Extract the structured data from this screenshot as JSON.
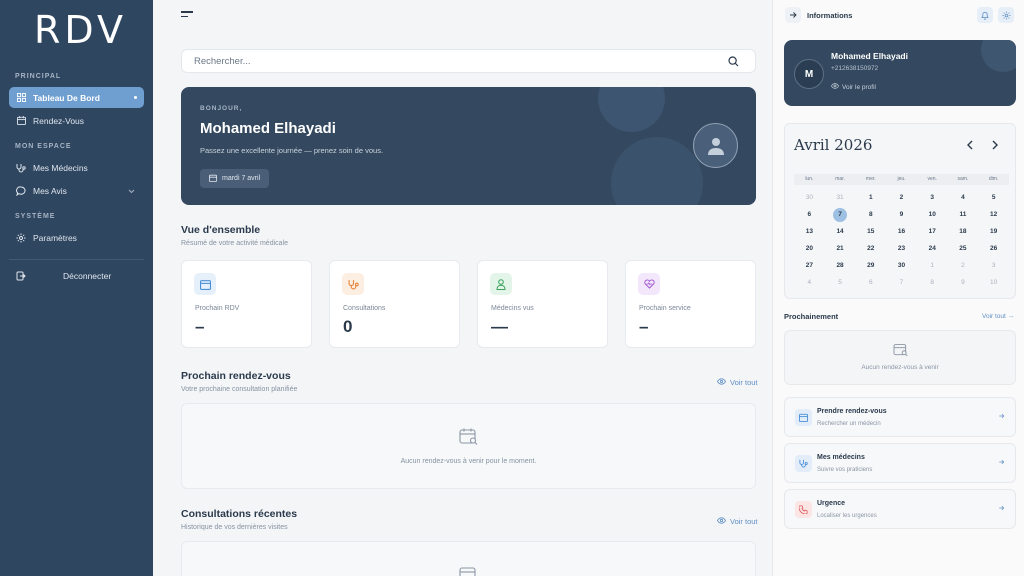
{
  "sidebar": {
    "logo": "RDV",
    "sections": [
      "PRINCIPAL",
      "MON ESPACE",
      "SYSTÈME"
    ],
    "items": [
      {
        "label": "Tableau De Bord",
        "icon": "grid-icon",
        "active": true
      },
      {
        "label": "Rendez-Vous",
        "icon": "calendar-icon"
      },
      {
        "label": "Mes Médecins",
        "icon": "stethoscope-icon"
      },
      {
        "label": "Mes Avis",
        "icon": "chat-bubble-icon"
      },
      {
        "label": "Paramètres",
        "icon": "gear-icon"
      }
    ],
    "logout": "Déconnecter"
  },
  "search": {
    "placeholder": "Rechercher..."
  },
  "hero": {
    "greeting": "BONJOUR,",
    "name": "Mohamed Elhayadi",
    "subtitle": "Passez une excellente journée — prenez soin de vous.",
    "date": "mardi 7 avril"
  },
  "overview": {
    "title": "Vue d'ensemble",
    "subtitle": "Résumé de votre activité médicale",
    "stats": [
      {
        "label": "Prochain RDV",
        "value": "–",
        "color": "#4a90d9",
        "bg": "#e6f0fb"
      },
      {
        "label": "Consultations",
        "value": "0",
        "color": "#e8843c",
        "bg": "#fdeee2"
      },
      {
        "label": "Médecins vus",
        "value": "—",
        "color": "#3aa15a",
        "bg": "#e2f5e8"
      },
      {
        "label": "Prochain service",
        "value": "–",
        "color": "#a05ad0",
        "bg": "#f3e8fb"
      }
    ]
  },
  "next_appointment": {
    "title": "Prochain rendez-vous",
    "subtitle": "Votre prochaine consultation planifiée",
    "link": "Voir tout",
    "empty": "Aucun rendez-vous à venir pour le moment."
  },
  "recent": {
    "title": "Consultations récentes",
    "subtitle": "Historique de vos dernières visites",
    "link": "Voir tout"
  },
  "right": {
    "title": "Informations",
    "profile": {
      "initial": "M",
      "name": "Mohamed Elhayadi",
      "phone": "+212638150972",
      "link": "Voir le profil"
    },
    "calendar": {
      "month": "Avril 2026",
      "weekdays": [
        "lun.",
        "mar.",
        "mer.",
        "jeu.",
        "ven.",
        "sam.",
        "dim."
      ],
      "days": [
        {
          "d": "30",
          "m": true
        },
        {
          "d": "31",
          "m": true
        },
        {
          "d": "1"
        },
        {
          "d": "2"
        },
        {
          "d": "3"
        },
        {
          "d": "4"
        },
        {
          "d": "5"
        },
        {
          "d": "6"
        },
        {
          "d": "7",
          "today": true
        },
        {
          "d": "8"
        },
        {
          "d": "9"
        },
        {
          "d": "10"
        },
        {
          "d": "11"
        },
        {
          "d": "12"
        },
        {
          "d": "13"
        },
        {
          "d": "14"
        },
        {
          "d": "15"
        },
        {
          "d": "16"
        },
        {
          "d": "17"
        },
        {
          "d": "18"
        },
        {
          "d": "19"
        },
        {
          "d": "20"
        },
        {
          "d": "21"
        },
        {
          "d": "22"
        },
        {
          "d": "23"
        },
        {
          "d": "24"
        },
        {
          "d": "25"
        },
        {
          "d": "26"
        },
        {
          "d": "27"
        },
        {
          "d": "28"
        },
        {
          "d": "29"
        },
        {
          "d": "30"
        },
        {
          "d": "1",
          "m": true
        },
        {
          "d": "2",
          "m": true
        },
        {
          "d": "3",
          "m": true
        },
        {
          "d": "4",
          "m": true
        },
        {
          "d": "5",
          "m": true
        },
        {
          "d": "6",
          "m": true
        },
        {
          "d": "7",
          "m": true
        },
        {
          "d": "8",
          "m": true
        },
        {
          "d": "9",
          "m": true
        },
        {
          "d": "10",
          "m": true
        }
      ]
    },
    "upcoming": {
      "title": "Prochainement",
      "link": "Voir tout →",
      "empty": "Aucun rendez-vous à venir"
    },
    "actions": [
      {
        "title": "Prendre rendez-vous",
        "sub": "Rechercher un médecin",
        "color": "#4a90d9",
        "bg": "#e2edf9"
      },
      {
        "title": "Mes médecins",
        "sub": "Suivre vos praticiens",
        "color": "#4a90d9",
        "bg": "#e2edf9"
      },
      {
        "title": "Urgence",
        "sub": "Localiser les urgences",
        "color": "#e0575b",
        "bg": "#fbe5e5"
      }
    ]
  }
}
